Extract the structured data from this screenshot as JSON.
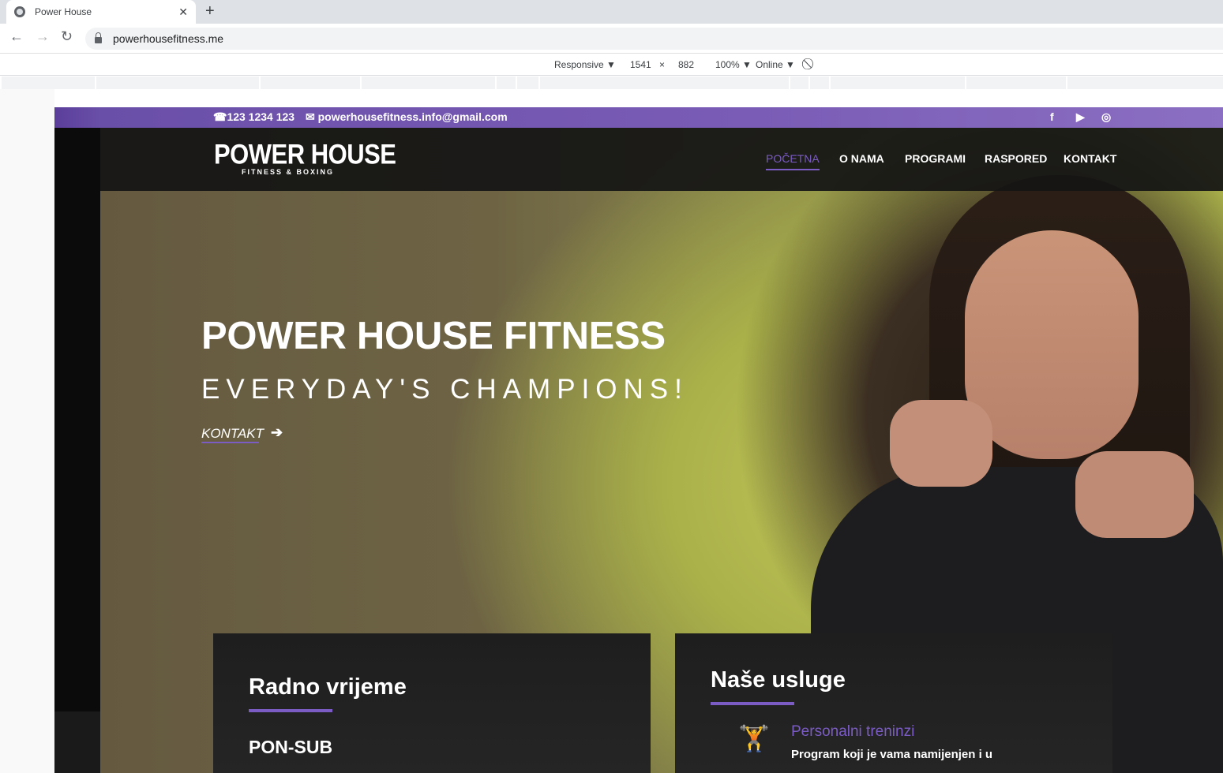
{
  "browser": {
    "tab_title": "Power House",
    "tab_close": "✕",
    "new_tab": "+",
    "url": "powerhousefitness.me",
    "back": "←",
    "forward": "→",
    "reload": "↻"
  },
  "devtools": {
    "device": "Responsive ▼",
    "width": "1541",
    "times": "×",
    "height": "882",
    "zoom": "100% ▼",
    "network": "Online ▼",
    "rotate": "⃠"
  },
  "site": {
    "topbar": {
      "phone": "☎123 1234 123",
      "email": "✉ powerhousefitness.info@gmail.com",
      "social": [
        "f",
        "▶",
        "◎"
      ]
    },
    "logo": {
      "main": "POWER HOUSE",
      "sub": "FITNESS & BOXING"
    },
    "nav": [
      "POČETNA",
      "O NAMA",
      "PROGRAMI",
      "RASPORED",
      "KONTAKT"
    ],
    "hero": {
      "title": "POWER HOUSE FITNESS",
      "subtitle": "EVERYDAY'S CHAMPIONS!",
      "cta": "KONTAKT",
      "cta_arrow": "➔"
    },
    "cards": {
      "hours": {
        "title": "Radno vrijeme",
        "days": "PON-SUB"
      },
      "services": {
        "title": "Naše usluge",
        "icon": "🏋",
        "item_title": "Personalni treninzi",
        "item_text": "Program koji je vama namijenjen i u"
      }
    }
  },
  "colors": {
    "accent": "#7b5cc4",
    "topbar": "#7a5cb6",
    "header": "#141414"
  }
}
